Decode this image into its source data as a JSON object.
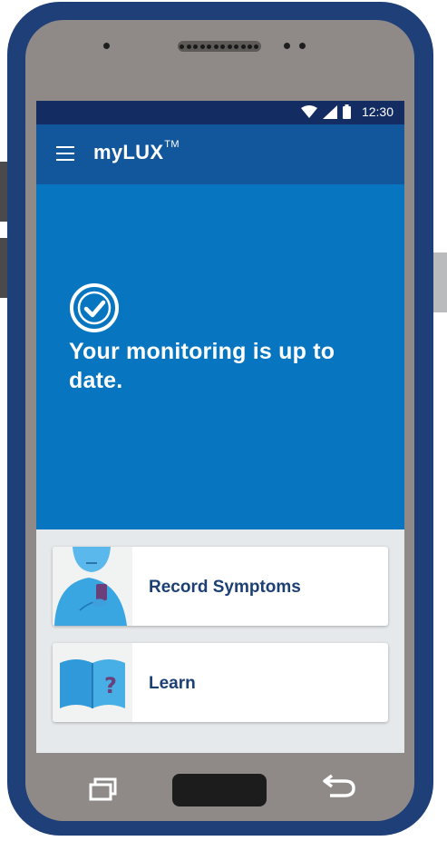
{
  "status_bar": {
    "time": "12:30",
    "icons": [
      "wifi-icon",
      "cell-signal-icon",
      "battery-icon"
    ]
  },
  "app_bar": {
    "menu_icon": "hamburger-menu-icon",
    "title": "myLUX",
    "trademark": "TM"
  },
  "hero": {
    "icon": "check-circle-icon",
    "message": "Your monitoring is up to date."
  },
  "cards": [
    {
      "label": "Record Symptoms",
      "image": "person-with-phone-illustration"
    },
    {
      "label": "Learn",
      "image": "book-question-illustration"
    }
  ],
  "nav_bar": {
    "recent": "recent-apps-icon",
    "home": "home-button",
    "back": "back-icon"
  },
  "colors": {
    "phone_frame": "#1f3f79",
    "bezel": "#8f8a88",
    "status_bar": "#132c62",
    "app_bar": "#12569c",
    "hero": "#0775bf",
    "card_label": "#1c3f74",
    "screen_bg": "#e6e9ec"
  }
}
